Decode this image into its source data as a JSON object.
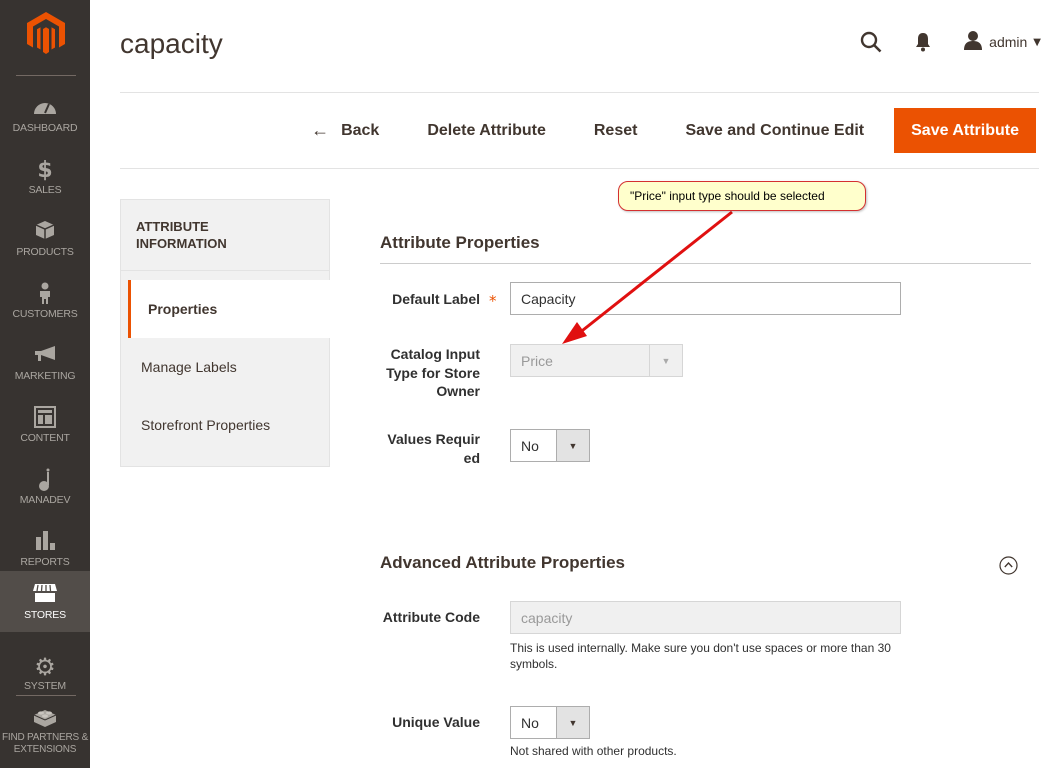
{
  "sidebar": {
    "items": [
      {
        "label": "DASHBOARD",
        "icon": "dashboard-icon"
      },
      {
        "label": "SALES",
        "icon": "dollar-icon"
      },
      {
        "label": "PRODUCTS",
        "icon": "box-icon"
      },
      {
        "label": "CUSTOMERS",
        "icon": "person-icon"
      },
      {
        "label": "MARKETING",
        "icon": "megaphone-icon"
      },
      {
        "label": "CONTENT",
        "icon": "layout-icon"
      },
      {
        "label": "MANADEV",
        "icon": "manadev-icon"
      },
      {
        "label": "REPORTS",
        "icon": "bar-chart-icon"
      },
      {
        "label": "STORES",
        "icon": "storefront-icon",
        "active": true
      },
      {
        "label": "SYSTEM",
        "icon": "gear-icon"
      },
      {
        "label": "FIND PARTNERS & EXTENSIONS",
        "icon": "lego-brick-icon"
      }
    ]
  },
  "header": {
    "title": "capacity",
    "user": "admin"
  },
  "toolbar": {
    "back_label": "Back",
    "delete_label": "Delete Attribute",
    "reset_label": "Reset",
    "save_continue_label": "Save and Continue Edit",
    "save_label": "Save Attribute"
  },
  "tabs": {
    "title": "ATTRIBUTE INFORMATION",
    "items": [
      {
        "label": "Properties",
        "active": true
      },
      {
        "label": "Manage Labels"
      },
      {
        "label": "Storefront Properties"
      }
    ]
  },
  "attribute_properties": {
    "title": "Attribute Properties",
    "default_label": {
      "label": "Default Label",
      "value": "Capacity",
      "required": true
    },
    "input_type": {
      "label": "Catalog Input Type for Store Owner",
      "value": "Price",
      "disabled": true
    },
    "values_required": {
      "label": "Values Required",
      "value": "No"
    }
  },
  "advanced_properties": {
    "title": "Advanced Attribute Properties",
    "attribute_code": {
      "label": "Attribute Code",
      "value": "capacity",
      "note": "This is used internally. Make sure you don't use spaces or more than 30 symbols."
    },
    "unique_value": {
      "label": "Unique Value",
      "value": "No",
      "note": "Not shared with other products."
    }
  },
  "annotation": {
    "text": "\"Price\" input type should be selected"
  },
  "colors": {
    "accent": "#eb5202",
    "sidebar_bg": "#373330",
    "sidebar_active": "#524d49",
    "annotation_bg": "#ffffcc",
    "annotation_arrow": "#e01010"
  }
}
